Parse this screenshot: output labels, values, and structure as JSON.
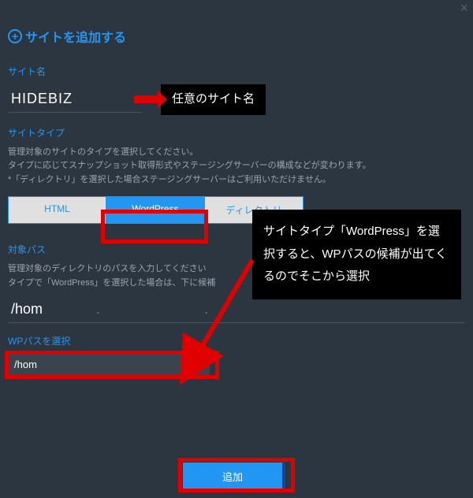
{
  "header": {
    "title": "サイトを追加する"
  },
  "site_name": {
    "label": "サイト名",
    "value": "HIDEBIZ",
    "annotation": "任意のサイト名"
  },
  "site_type": {
    "label": "サイトタイプ",
    "help_line1": "管理対象のサイトのタイプを選択してください。",
    "help_line2": "タイプに応じてスナップショット取得形式やステージングサーバーの構成などが変わります。",
    "help_line3": "*「ディレクトリ」を選択した場合ステージングサーバーはご利用いただけません。",
    "tabs": {
      "html": "HTML",
      "wordpress": "WordPress",
      "directory": "ディレクトリ"
    },
    "annotation": "サイトタイプ「WordPress」を選択すると、WPパスの候補が出てくるのでそこから選択"
  },
  "target_path": {
    "label": "対象パス",
    "help_line1": "管理対象のディレクトリのパスを入力してください",
    "help_line2": "タイプで「WordPress」を選択した場合は、下に候補",
    "value": "/hom"
  },
  "wp_path": {
    "label": "WPパスを選択",
    "value": "/hom"
  },
  "submit": {
    "label": "追加"
  }
}
